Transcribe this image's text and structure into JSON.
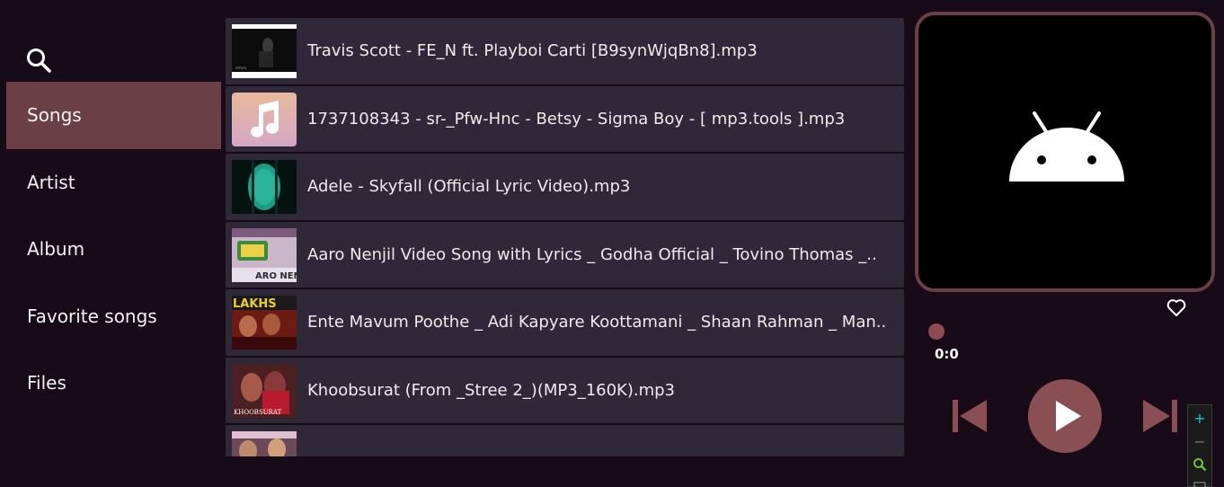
{
  "sidebar": {
    "search_icon": "search-icon",
    "items": [
      {
        "label": "Songs",
        "active": true
      },
      {
        "label": "Artist",
        "active": false
      },
      {
        "label": "Album",
        "active": false
      },
      {
        "label": "Favorite songs",
        "active": false
      },
      {
        "label": "Files",
        "active": false
      }
    ]
  },
  "songs": [
    {
      "title": "Travis Scott - FE_N ft. Playboi Carti [B9synWjqBn8].mp3",
      "thumb": "video-frame-dark"
    },
    {
      "title": "1737108343 - sr-_Pfw-Hnc - Betsy - Sigma Boy - [ mp3.tools ].mp3",
      "thumb": "music-note-icon"
    },
    {
      "title": "Adele - Skyfall (Official Lyric Video).mp3",
      "thumb": "teal-circle"
    },
    {
      "title": "Aaro Nenjil Video Song with Lyrics _ Godha Official _ Tovino Thomas _..",
      "thumb": "movie-poster"
    },
    {
      "title": "Ente Mavum Poothe _ Adi Kapyare Koottamani _ Shaan Rahman _ Man..",
      "thumb": "movie-poster"
    },
    {
      "title": "Khoobsurat (From _Stree 2_)(MP3_160K).mp3",
      "thumb": "movie-poster"
    },
    {
      "title": "",
      "thumb": "movie-poster"
    }
  ],
  "player": {
    "art_icon": "android-icon",
    "favorite_icon": "heart-outline-icon",
    "time": "0:0",
    "progress": 0,
    "colors": {
      "accent": "#8a4f53",
      "background": "#170b17",
      "row": "#2e2838",
      "active_nav": "#6a3f45"
    }
  },
  "zoom": {
    "plus": "+",
    "minus": "−"
  }
}
